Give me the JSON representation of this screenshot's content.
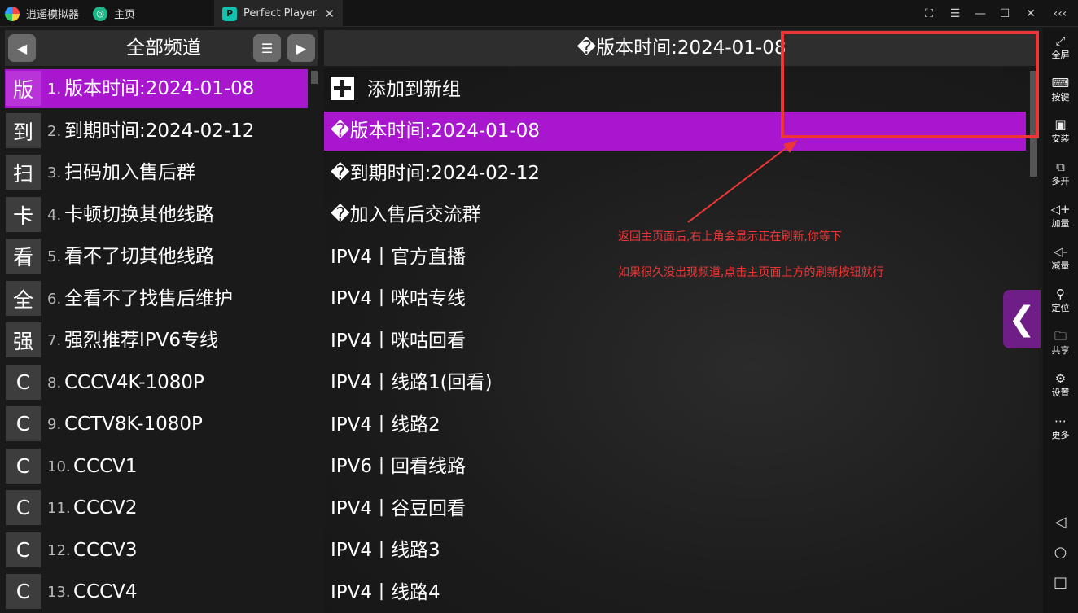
{
  "titlebar": {
    "app_tab": "逍遥模拟器",
    "home_tab": "主页",
    "active_tab": "Perfect Player",
    "active_tab_logo": "P",
    "home_tab_logo": "◎",
    "close_tab": "✕",
    "window_controls": [
      "⛶",
      "☰",
      "—",
      "☐",
      "✕"
    ],
    "collapse": "‹‹‹"
  },
  "left_panel": {
    "prev_icon": "◀",
    "menu_icon": "☰",
    "next_icon": "▶",
    "title": "全部频道",
    "channels": [
      {
        "icon": "版",
        "num": "1.",
        "name": "版本时间:2024-01-08"
      },
      {
        "icon": "到",
        "num": "2.",
        "name": "到期时间:2024-02-12"
      },
      {
        "icon": "扫",
        "num": "3.",
        "name": "扫码加入售后群"
      },
      {
        "icon": "卡",
        "num": "4.",
        "name": "卡顿切换其他线路"
      },
      {
        "icon": "看",
        "num": "5.",
        "name": "看不了切其他线路"
      },
      {
        "icon": "全",
        "num": "6.",
        "name": "全看不了找售后维护"
      },
      {
        "icon": "强",
        "num": "7.",
        "name": "强烈推荐IPV6专线"
      },
      {
        "icon": "C",
        "num": "8.",
        "name": "CCCV4K-1080P"
      },
      {
        "icon": "C",
        "num": "9.",
        "name": "CCTV8K-1080P"
      },
      {
        "icon": "C",
        "num": "10.",
        "name": "CCCV1"
      },
      {
        "icon": "C",
        "num": "11.",
        "name": "CCCV2"
      },
      {
        "icon": "C",
        "num": "12.",
        "name": "CCCV3"
      },
      {
        "icon": "C",
        "num": "13.",
        "name": "CCCV4"
      }
    ]
  },
  "right_panel": {
    "title": "�版本时间:2024-01-08",
    "add_group": "添加到新组",
    "sources": [
      "�版本时间:2024-01-08",
      "�到期时间:2024-02-12",
      "�加入售后交流群",
      "IPV4丨官方直播",
      "IPV4丨咪咕专线",
      "IPV4丨咪咕回看",
      "IPV4丨线路1(回看)",
      "IPV4丨线路2",
      "IPV6丨回看线路",
      "IPV4丨谷豆回看",
      "IPV4丨线路3",
      "IPV4丨线路4"
    ],
    "collapse_icon": "❮"
  },
  "annotation": {
    "line1": "返回主页面后,右上角会显示正在刷新,你等下",
    "line2": "如果很久没出现频道,点击主页面上方的刷新按钮就行",
    "color": "#ee3636"
  },
  "sidebar": {
    "items": [
      {
        "icon": "⤢",
        "label": "全屏"
      },
      {
        "icon": "⌨",
        "label": "按键"
      },
      {
        "icon": "▣",
        "label": "安装"
      },
      {
        "icon": "⧉",
        "label": "多开"
      },
      {
        "icon": "◁+",
        "label": "加量"
      },
      {
        "icon": "◁-",
        "label": "减量"
      },
      {
        "icon": "⚲",
        "label": "定位"
      },
      {
        "icon": "🗀",
        "label": "共享"
      },
      {
        "icon": "⚙",
        "label": "设置"
      },
      {
        "icon": "⋯",
        "label": "更多"
      }
    ],
    "nav": [
      "◁",
      "○",
      "□"
    ]
  },
  "colors": {
    "accent": "#a817ce",
    "header": "#2e2e2e",
    "background": "#1a1a1a"
  }
}
